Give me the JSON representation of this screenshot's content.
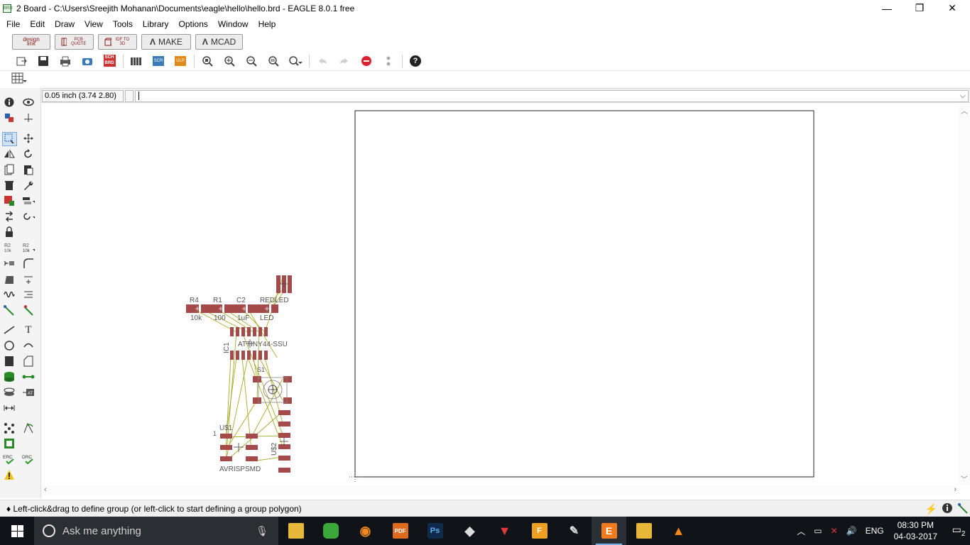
{
  "window": {
    "title": "2 Board - C:\\Users\\Sreejith Mohanan\\Documents\\eagle\\hello\\hello.brd - EAGLE 8.0.1 free",
    "icon_text": "BRD",
    "minimize_glyph": "—",
    "restore_glyph": "❐",
    "close_glyph": "✕"
  },
  "menu": [
    "File",
    "Edit",
    "Draw",
    "View",
    "Tools",
    "Library",
    "Options",
    "Window",
    "Help"
  ],
  "special_toolbar": {
    "designlink_label": "design link",
    "pcb_quote_label": "PCB QUOTE",
    "idf_to_3d_label": "IDF TO 3D",
    "make_label": "MAKE",
    "mcad_label": "MCAD"
  },
  "toolbar": {
    "sch_brd_label": "SCH BRD",
    "scr_label": "SCR",
    "ulp_label": "ULP",
    "help_glyph": "?"
  },
  "command": {
    "coordinate": "0.05 inch (3.74 2.80)",
    "value": ""
  },
  "board": {
    "labels": {
      "r4": "R4",
      "r1": "R1",
      "c2": "C2",
      "redled": "REDLED",
      "r4_value": "10k",
      "r1_value": "100",
      "c2_value": "1uF",
      "led_value": "LED",
      "ic1": "IC1",
      "ic1_value": "ATTINY44-SSU",
      "s1": "S1",
      "uss1": "U$1",
      "pin1": "1",
      "uss2": "U$2",
      "avrisp": "AVRISPSMD"
    },
    "colors": {
      "pad": "#a54a4a",
      "airwire": "#a9a92a",
      "outline": "#222222",
      "label": "#555555"
    }
  },
  "status": {
    "text": "Left-click&drag to define group (or left-click to start defining a group polygon)"
  },
  "taskbar": {
    "search_placeholder": "Ask me anything",
    "language": "ENG",
    "time": "08:30 PM",
    "date": "04-03-2017",
    "notification_count": "2"
  }
}
